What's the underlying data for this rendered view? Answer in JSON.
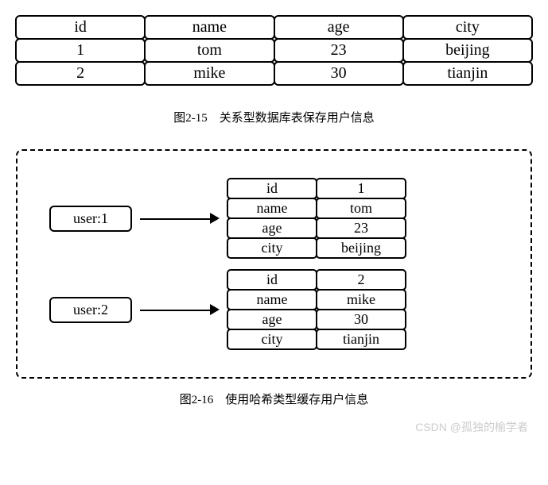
{
  "chart_data": {
    "type": "table",
    "top_table": {
      "headers": [
        "id",
        "name",
        "age",
        "city"
      ],
      "rows": [
        [
          "1",
          "tom",
          "23",
          "beijing"
        ],
        [
          "2",
          "mike",
          "30",
          "tianjin"
        ]
      ]
    },
    "hash_entries": [
      {
        "key": "user:1",
        "fields": [
          [
            "id",
            "1"
          ],
          [
            "name",
            "tom"
          ],
          [
            "age",
            "23"
          ],
          [
            "city",
            "beijing"
          ]
        ]
      },
      {
        "key": "user:2",
        "fields": [
          [
            "id",
            "2"
          ],
          [
            "name",
            "mike"
          ],
          [
            "age",
            "30"
          ],
          [
            "city",
            "tianjin"
          ]
        ]
      }
    ]
  },
  "captions": {
    "fig215": "图2-15　关系型数据库表保存用户信息",
    "fig216": "图2-16　使用哈希类型缓存用户信息"
  },
  "watermark": "CSDN @孤独的榆学者"
}
